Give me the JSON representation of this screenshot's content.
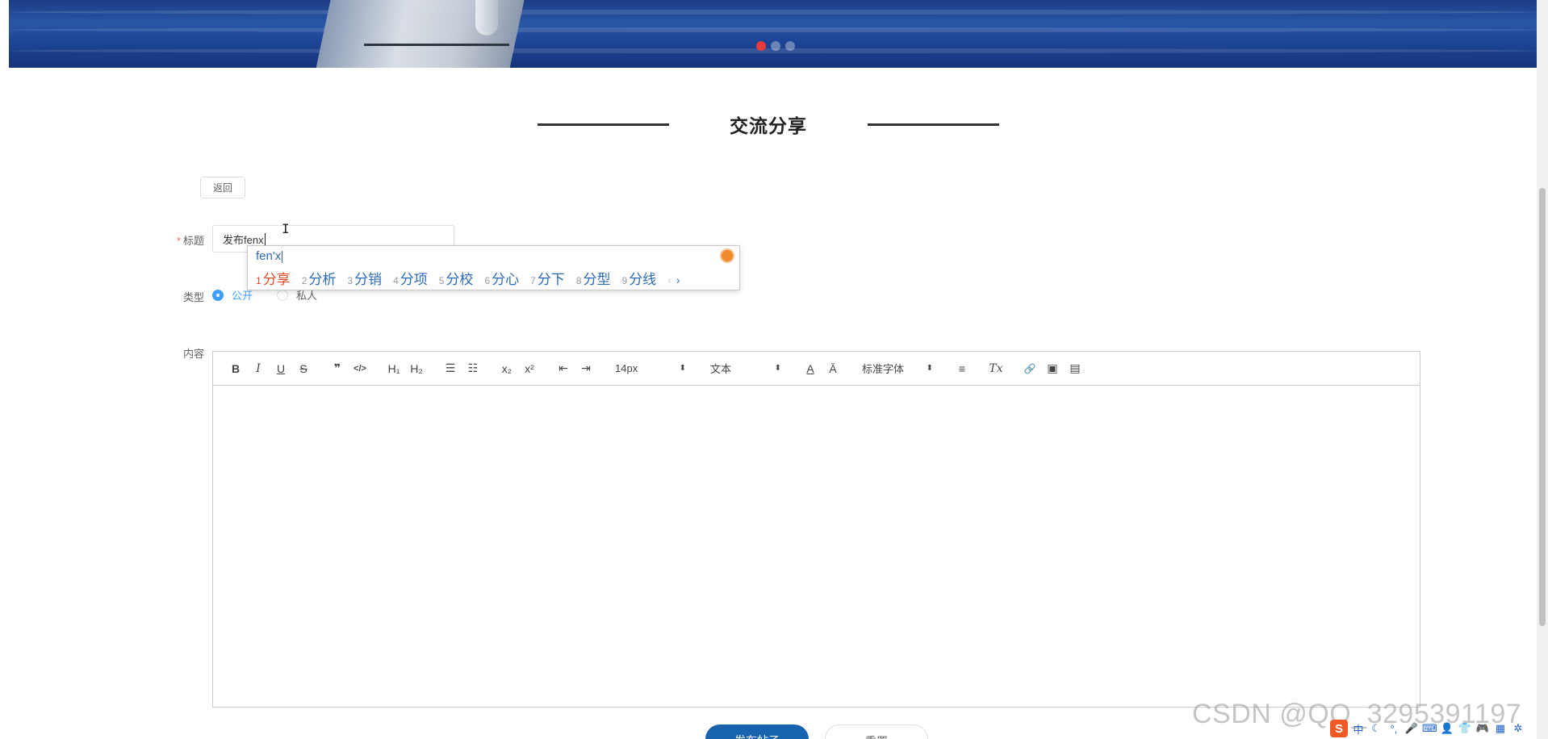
{
  "banner": {
    "carousel_dots": 3,
    "active_dot": 0
  },
  "section": {
    "title": "交流分享"
  },
  "form": {
    "back_label": "返回",
    "title_label": "标题",
    "title_value": "发布fenx",
    "type_label": "类型",
    "type_options": [
      "公开",
      "私人"
    ],
    "type_selected": "公开",
    "content_label": "内容"
  },
  "ime": {
    "pinyin": "fen'x",
    "candidates": [
      {
        "num": "1",
        "text": "分享"
      },
      {
        "num": "2",
        "text": "分析"
      },
      {
        "num": "3",
        "text": "分销"
      },
      {
        "num": "4",
        "text": "分项"
      },
      {
        "num": "5",
        "text": "分校"
      },
      {
        "num": "6",
        "text": "分心"
      },
      {
        "num": "7",
        "text": "分下"
      },
      {
        "num": "8",
        "text": "分型"
      },
      {
        "num": "9",
        "text": "分线"
      }
    ],
    "prev": "‹",
    "next": "›"
  },
  "toolbar": {
    "bold": "B",
    "italic": "I",
    "underline": "U",
    "strike": "S",
    "blockquote": "❞",
    "code": "</>",
    "h1": "H₁",
    "h2": "H₂",
    "ordered_list": "☰",
    "bullet_list": "☷",
    "subscript": "x₂",
    "superscript": "x²",
    "outdent": "⇤",
    "indent": "⇥",
    "size": "14px",
    "header": "文本",
    "font": "标准字体",
    "color": "A",
    "background": "Ā",
    "align": "≡",
    "clean": "Tx",
    "link": "🔗",
    "image": "▣",
    "video": "▤"
  },
  "actions": {
    "submit": "发布帖子",
    "reset": "重置"
  },
  "watermark": "CSDN @QQ_3295391197",
  "tray": {
    "logo": "S",
    "lang": "中"
  }
}
